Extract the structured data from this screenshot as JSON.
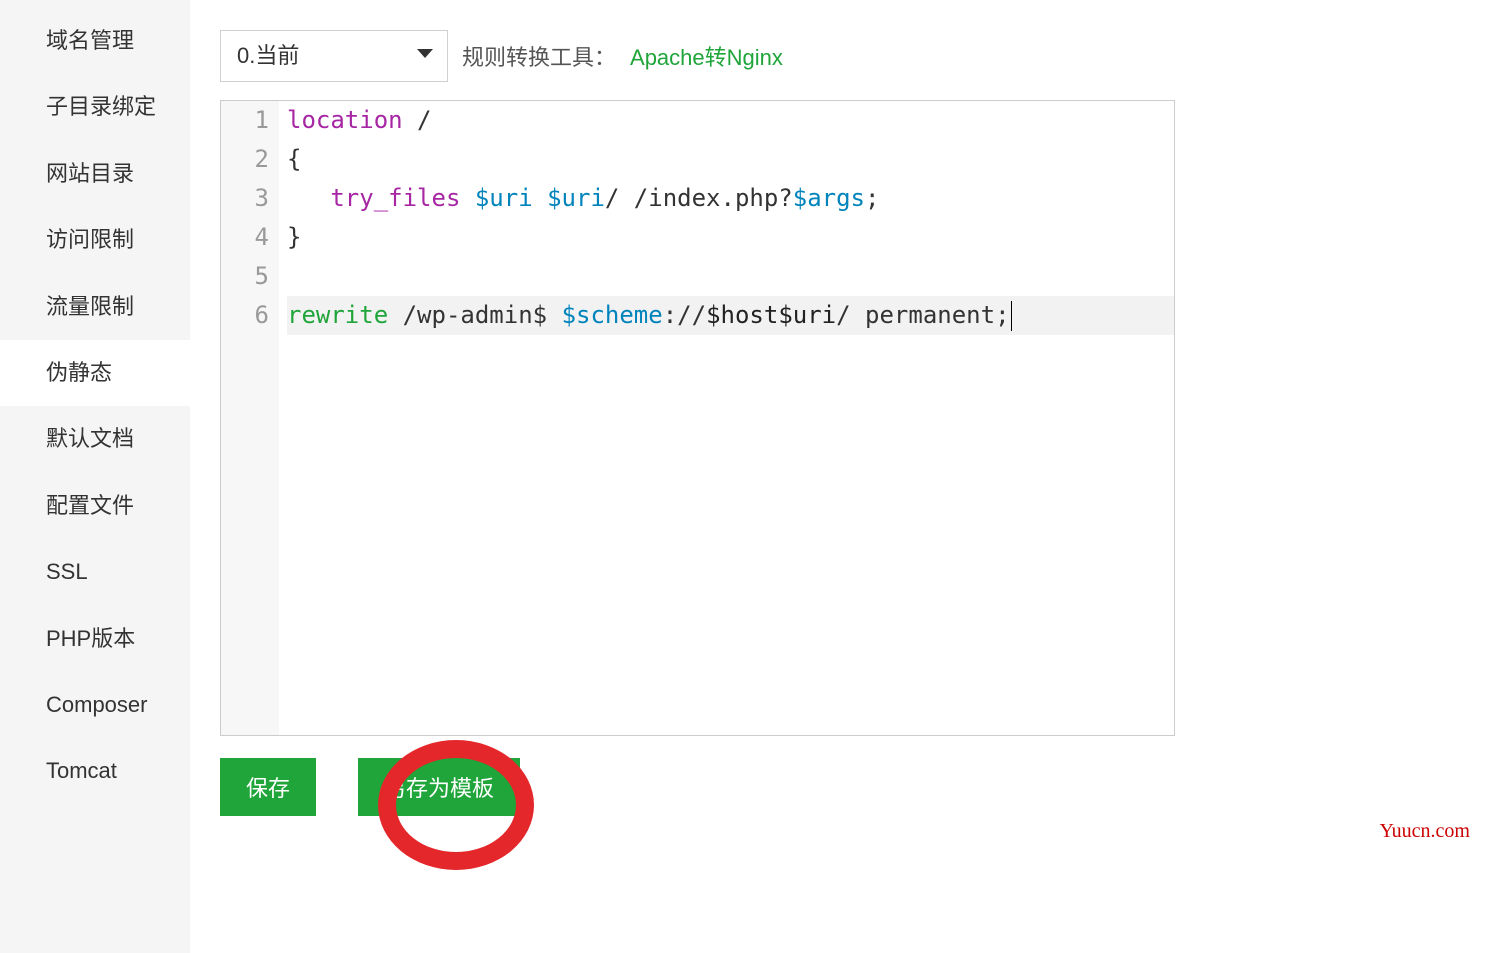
{
  "sidebar": {
    "items": [
      {
        "label": "域名管理"
      },
      {
        "label": "子目录绑定"
      },
      {
        "label": "网站目录"
      },
      {
        "label": "访问限制"
      },
      {
        "label": "流量限制"
      },
      {
        "label": "伪静态"
      },
      {
        "label": "默认文档"
      },
      {
        "label": "配置文件"
      },
      {
        "label": "SSL"
      },
      {
        "label": "PHP版本"
      },
      {
        "label": "Composer"
      },
      {
        "label": "Tomcat"
      }
    ],
    "active_index": 5
  },
  "toolbar": {
    "select_value": "0.当前",
    "label": "规则转换工具：",
    "link": "Apache转Nginx"
  },
  "editor": {
    "line_numbers": [
      "1",
      "2",
      "3",
      "4",
      "5",
      "6"
    ],
    "lines": {
      "l1_kw": "location",
      "l1_rest": " /",
      "l2": "{",
      "l3_indent": "   ",
      "l3_kw": "try_files",
      "l3_sp1": " ",
      "l3_var1": "$uri",
      "l3_sp2": " ",
      "l3_var2": "$uri",
      "l3_mid": "/ /index.php?",
      "l3_var3": "$args",
      "l3_end": ";",
      "l4": "}",
      "l5": "",
      "l6_kw": "rewrite",
      "l6_sp1": " ",
      "l6_path": "/wp-admin$",
      "l6_sp2": " ",
      "l6_var1": "$scheme",
      "l6_colon": "://",
      "l6_var2": "$host$uri",
      "l6_rest": "/ permanent;"
    }
  },
  "buttons": {
    "save": "保存",
    "save_as": "另存为模板"
  },
  "watermark": "Yuucn.com"
}
